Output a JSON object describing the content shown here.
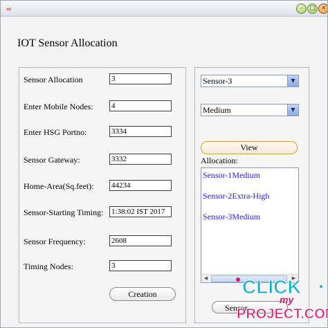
{
  "window": {
    "title": "",
    "minimize_glyph": "–",
    "maximize_glyph": "□",
    "close_glyph": "×",
    "app_icon_glyph": "☕"
  },
  "app_title": "IOT Sensor Allocation",
  "form": {
    "fields": [
      {
        "label": "Sensor Allocation",
        "value": "3"
      },
      {
        "label": "Enter Mobile Nodes:",
        "value": "4"
      },
      {
        "label": "Enter HSG Portno:",
        "value": "3334"
      },
      {
        "label": "Sensor Gateway:",
        "value": "3332"
      },
      {
        "label": "Home-Area(Sq.feet):",
        "value": "44234"
      },
      {
        "label": "Sensor-Starting Timing:",
        "value": "1:38:02 IST 2017"
      },
      {
        "label": "Sensor Frequency:",
        "value": "2608"
      },
      {
        "label": "Timing Nodes:",
        "value": "3"
      }
    ],
    "creation_button": "Creation"
  },
  "right": {
    "sensor_select": "Sensor-3",
    "level_select": "Medium",
    "view_button": "View",
    "allocation_label": "Allocation:",
    "allocation_items": [
      "Sensor-1Medium",
      "Sensor-2Extra-High",
      "Sensor-3Medium"
    ],
    "sensor_button": "Sensor"
  },
  "watermark": {
    "line1": "CLICK",
    "line2": "my",
    "line3": "PROJECT.COM"
  },
  "colors": {
    "allocation_text": "#2424c8",
    "watermark_pink": "#d21a6e",
    "watermark_cyan": "#1ab0c8"
  }
}
